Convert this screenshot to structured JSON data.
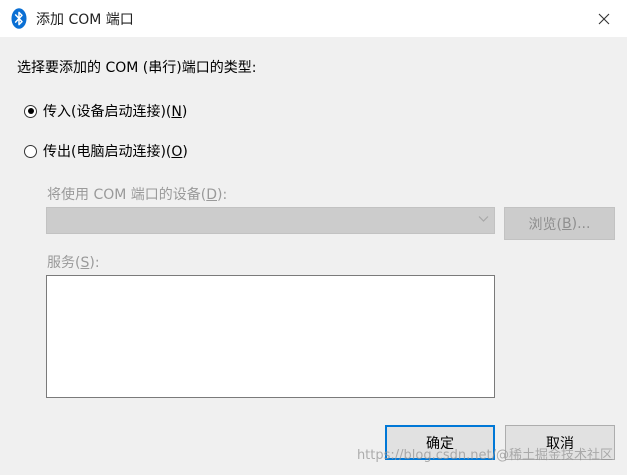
{
  "window": {
    "title": "添加 COM 端口",
    "close_glyph": "✕"
  },
  "dialog": {
    "prompt": "选择要添加的 COM (串行)端口的类型:",
    "incoming": {
      "label": "传入(设备启动连接)(",
      "key": "N",
      "suffix": ")",
      "checked": true
    },
    "outgoing": {
      "label": "传出(电脑启动连接)(",
      "key": "O",
      "suffix": ")",
      "checked": false
    },
    "device_label": {
      "text": "将使用 COM 端口的设备(",
      "key": "D",
      "suffix": "):"
    },
    "device_select": {
      "value": "",
      "enabled": false
    },
    "browse_button": {
      "text": "浏览(",
      "key": "B",
      "suffix": ")..."
    },
    "service_label": {
      "text": "服务(",
      "key": "S",
      "suffix": "):"
    },
    "service_list": {
      "items": []
    }
  },
  "buttons": {
    "ok": "确定",
    "cancel": "取消"
  },
  "watermark": "https://blog.csdn.net/@稀土掘金技术社区",
  "colors": {
    "bluetooth_icon": "#0a6fd4",
    "client_bg": "#f0f0f0",
    "disabled_text": "#9a9a9a",
    "default_button_border": "#0078d7"
  },
  "icons": {
    "app_icon": "bluetooth-icon",
    "close": "close-icon",
    "dropdown": "chevron-down-icon"
  }
}
